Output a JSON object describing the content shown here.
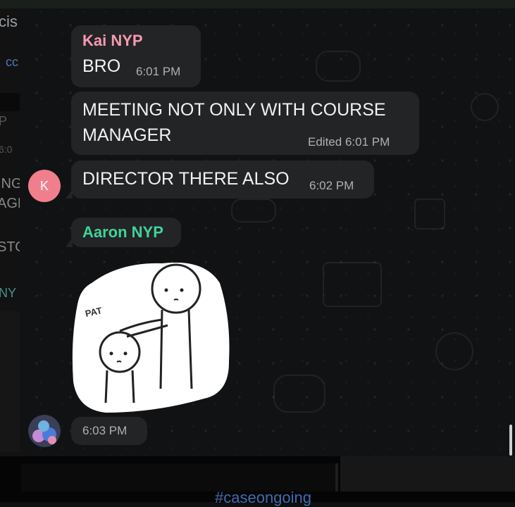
{
  "left_pane": {
    "fragments": [
      "cis",
      "cc",
      "P",
      "6:0",
      "ING",
      "AGE",
      "STO",
      "NY"
    ]
  },
  "messages": [
    {
      "sender": "Kai NYP",
      "sender_color": "#f59ab0",
      "text": "BRO",
      "time": "6:01 PM"
    },
    {
      "text_lines": [
        "MEETING NOT ONLY WITH COURSE",
        "MANAGER"
      ],
      "status": "Edited",
      "time": "6:01 PM"
    },
    {
      "avatar_initial": "K",
      "avatar_color": "#f07f8e",
      "text": "DIRECTOR THERE ALSO",
      "time": "6:02 PM"
    },
    {
      "sender": "Aaron NYP",
      "sender_color": "#41d39a",
      "sticker_text": "PAT",
      "time": "6:03 PM"
    }
  ],
  "bottom": {
    "hashtag": "#caseongoing"
  },
  "colors": {
    "bubble": "#232426",
    "background": "#111214",
    "timestamp": "#aeb0b3"
  }
}
